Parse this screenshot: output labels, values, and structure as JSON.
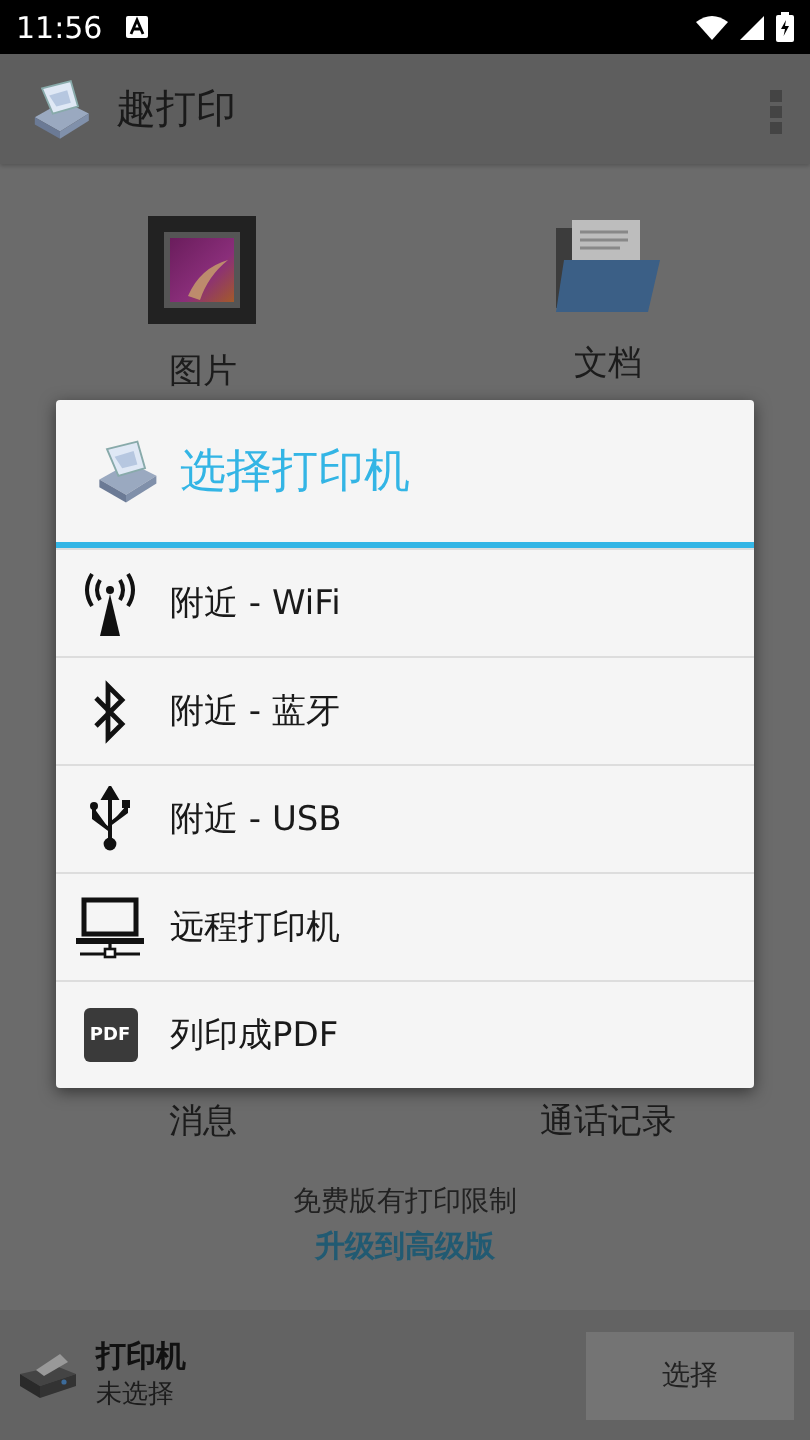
{
  "status_bar": {
    "time": "11:56"
  },
  "app_bar": {
    "title": "趣打印"
  },
  "home_items": [
    {
      "label": "图片",
      "kind": "picture"
    },
    {
      "label": "文档",
      "kind": "folder"
    }
  ],
  "home_items_bottom": [
    {
      "label": "消息"
    },
    {
      "label": "通话记录"
    }
  ],
  "notice": {
    "text": "免费版有打印限制",
    "link": "升级到高级版"
  },
  "printer_bar": {
    "title": "打印机",
    "status": "未选择",
    "button": "选择"
  },
  "dialog": {
    "title": "选择打印机",
    "options": [
      {
        "kind": "wifi",
        "label": "附近 - WiFi"
      },
      {
        "kind": "bluetooth",
        "label": "附近 - 蓝牙"
      },
      {
        "kind": "usb",
        "label": "附近 - USB"
      },
      {
        "kind": "remote",
        "label": "远程打印机"
      },
      {
        "kind": "pdf",
        "label": "列印成PDF",
        "badge": "PDF"
      }
    ]
  }
}
